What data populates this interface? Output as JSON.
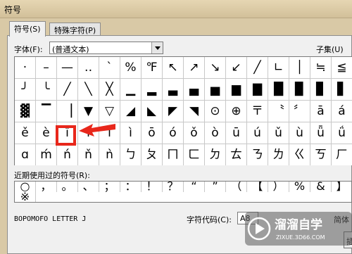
{
  "window": {
    "title": "符号"
  },
  "tabs": [
    {
      "label": "符号(S)"
    },
    {
      "label": "特殊字符(P)"
    }
  ],
  "font_label": "字体(F):",
  "font_value": "(普通文本)",
  "subset_label": "子集(U)",
  "symbol_rows": [
    [
      "·",
      "–",
      "—",
      "‥",
      "ˋ",
      "%",
      "℉",
      "↖",
      "↗",
      "↘",
      "↙",
      "╱",
      "∟",
      "│",
      "≒",
      "≦"
    ],
    [
      "╯",
      "╰",
      "╱",
      "╲",
      "╳",
      "▁",
      "▂",
      "▃",
      "▄",
      "▅",
      "▆",
      "▇",
      "█",
      "▉",
      "▊",
      "▋"
    ],
    [
      "▓",
      "▔",
      "▕",
      "▼",
      "▽",
      "◢",
      "◣",
      "◤",
      "◥",
      "⊙",
      "⊕",
      "〒",
      "〝",
      "〞",
      "ā",
      "á"
    ],
    [
      "ě",
      "è",
      "ī",
      "í",
      "ǐ",
      "ì",
      "ō",
      "ó",
      "ǒ",
      "ò",
      "ū",
      "ú",
      "ǔ",
      "ù",
      "ǖ",
      "ǘ"
    ],
    [
      "ɑ",
      "ḿ",
      "ń",
      "ň",
      "ǹ",
      "ㄅ",
      "ㄆ",
      "ㄇ",
      "ㄈ",
      "ㄉ",
      "ㄊ",
      "ㄋ",
      "ㄌ",
      "ㄍ",
      "ㄎ",
      "ㄏ"
    ]
  ],
  "recent_label": "近期使用过的符号(R):",
  "recent_symbols": [
    "○",
    "，",
    "。",
    "、",
    "；",
    "：",
    "！",
    "？",
    "“",
    "”",
    "（",
    "【",
    "）",
    "%",
    "&",
    "】",
    "※"
  ],
  "char_name": "BOPOMOFO LETTER J",
  "charcode_label": "字符代码(C):",
  "charcode_value": "A8",
  "simplified_label": "简体",
  "insert_button": "插",
  "watermark": {
    "brand": "溜溜自学",
    "url": "ZIXUE.3D66.COM"
  },
  "highlight_color": "#e8271b"
}
